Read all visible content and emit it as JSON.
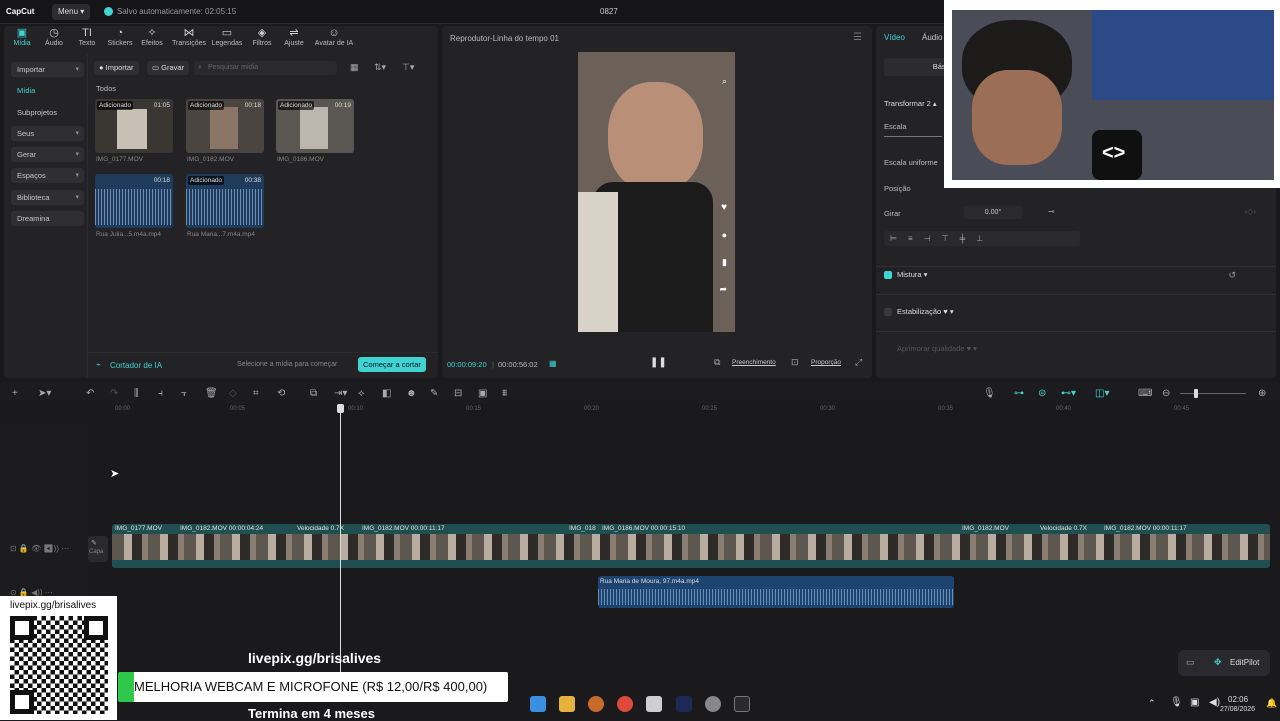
{
  "topbar": {
    "logo": "CapCut",
    "menu_label": "Menu",
    "autosave": "Salvo automaticamente: 02:05:15",
    "project_title": "0827"
  },
  "toolbar": [
    {
      "label": "Mídia",
      "icon": "media-icon"
    },
    {
      "label": "Áudio",
      "icon": "audio-icon"
    },
    {
      "label": "Texto",
      "icon": "text-icon"
    },
    {
      "label": "Stickers",
      "icon": "sticker-icon"
    },
    {
      "label": "Efeitos",
      "icon": "effects-icon"
    },
    {
      "label": "Transições",
      "icon": "transitions-icon"
    },
    {
      "label": "Legendas",
      "icon": "captions-icon"
    },
    {
      "label": "Filtros",
      "icon": "filters-icon"
    },
    {
      "label": "Ajuste",
      "icon": "adjust-icon"
    },
    {
      "label": "Avatar de IA",
      "icon": "ai-avatar-icon"
    }
  ],
  "sidebar": [
    {
      "label": "Importar",
      "chevron": true
    },
    {
      "label": "Mídia",
      "chevron": false
    },
    {
      "label": "Subprojetos",
      "chevron": false
    },
    {
      "label": "Seus",
      "chevron": true
    },
    {
      "label": "Gerar",
      "chevron": true
    },
    {
      "label": "Espaços",
      "chevron": true
    },
    {
      "label": "Biblioteca",
      "chevron": true
    },
    {
      "label": "Dreamina",
      "chevron": false
    }
  ],
  "media": {
    "import_btn": "Importar",
    "record_btn": "Gravar",
    "search_placeholder": "Pesquisar mídia",
    "section": "Todos",
    "items": [
      {
        "name": "IMG_0177.MOV",
        "badge": "Adicionado",
        "duration": "01:05"
      },
      {
        "name": "IMG_0182.MOV",
        "badge": "Adicionado",
        "duration": "00:18"
      },
      {
        "name": "IMG_0186.MOV",
        "badge": "Adicionado",
        "duration": "00:19"
      },
      {
        "name": "Rua Julia...5.m4a.mp4",
        "badge": "",
        "duration": "00:18"
      },
      {
        "name": "Rua Maria...7.m4a.mp4",
        "badge": "Adicionado",
        "duration": "00:38"
      }
    ],
    "footer_label": "Cortador de IA",
    "footer_hint": "Selecione a mídia para começar",
    "footer_btn": "Começar a cortar"
  },
  "player": {
    "title": "Reprodutor-Linha do tempo 01",
    "current_time": "00:00:09:20",
    "total_time": "00:00:56:02",
    "fill_btn": "Preenchimento",
    "ratio_btn": "Proporção"
  },
  "properties": {
    "tabs": [
      "Vídeo",
      "Áudio"
    ],
    "subtab": "Básico",
    "transform": "Transformar 2",
    "scale": "Escala",
    "uniform_scale": "Escala uniforme",
    "position": "Posição",
    "rotate": "Girar",
    "rotate_value": "0.00°",
    "blend": "Mistura",
    "stabilization": "Estabilização",
    "enhance": "Aprimorar qualidade"
  },
  "timeline": {
    "ticks": [
      "00:00",
      "00:05",
      "00:10",
      "00:15",
      "00:20",
      "00:25",
      "00:30",
      "00:35",
      "00:40",
      "00:45"
    ],
    "cover_label": "Capa",
    "clips": [
      {
        "name": "IMG_0177.MOV"
      },
      {
        "name": "IMG_0182.MOV 00:00:04:24"
      },
      {
        "name": "Velocidade 0.7X"
      },
      {
        "name": "IMG_0182.MOV 00:00:11:17"
      },
      {
        "name": "IMG_018"
      },
      {
        "name": "IMG_0186.MOV 00:00:15:10"
      },
      {
        "name": "IMG_0182.MOV"
      },
      {
        "name": "Velocidade 0.7X"
      },
      {
        "name": "IMG_0182.MOV 00:00:11:17"
      }
    ],
    "audio_clip": "Rua Maria de Moura, 97.m4a.mp4"
  },
  "overlay": {
    "qr_url": "livepix.gg/brisalives",
    "stream_url": "livepix.gg/brisalives",
    "goal_text": "MELHORIA WEBCAM E MICROFONE (R$ 12,00/R$ 400,00)",
    "goal_progress": 0.03,
    "goal_ends": "Termina em 4 meses",
    "editpilot": "EditPilot"
  },
  "taskbar": {
    "time": "02:06",
    "date": "27/08/2026"
  },
  "colors": {
    "accent": "#3fd3d1",
    "track": "#1f4f50",
    "audio": "#1d4470",
    "goal_green": "#2fc84a"
  }
}
